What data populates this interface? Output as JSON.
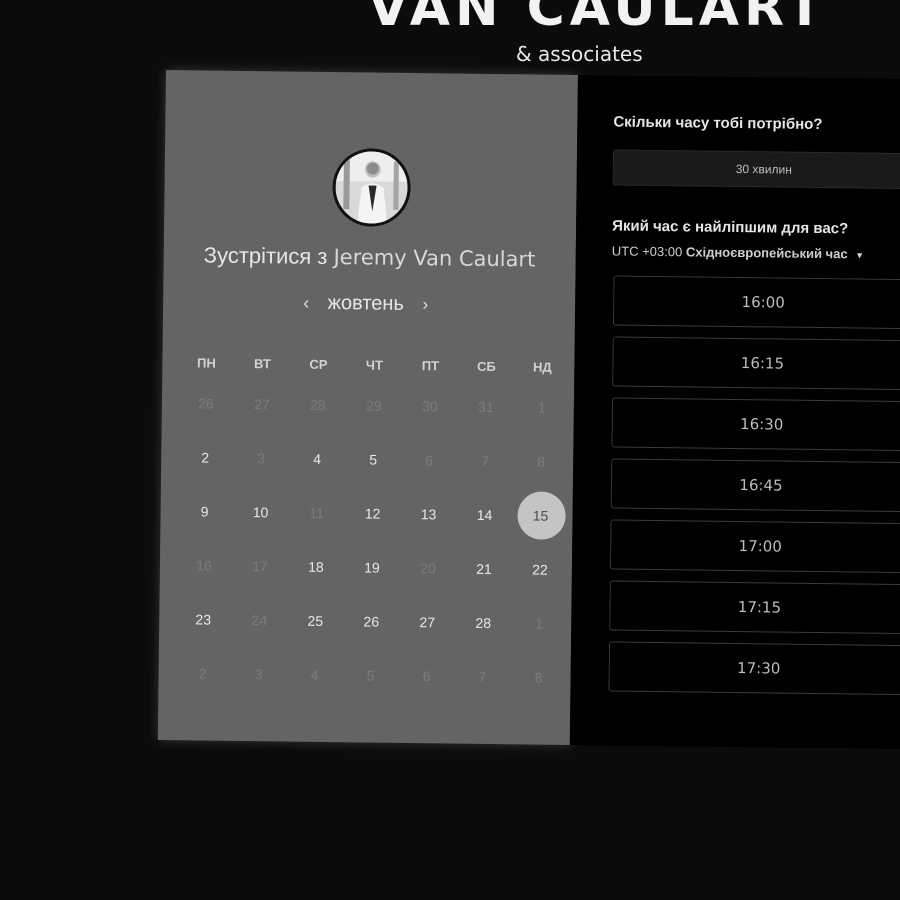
{
  "brand": {
    "name": "VAN CAULART",
    "sub": "& associates"
  },
  "calendar": {
    "title_prefix": "Зустрітися з",
    "host_name": "Jeremy Van Caulart",
    "month": "жовтень",
    "prev_icon": "‹",
    "next_icon": "›",
    "weekdays": [
      "ПН",
      "ВТ",
      "СР",
      "ЧТ",
      "ПТ",
      "СБ",
      "НД"
    ],
    "weeks": [
      [
        {
          "d": "26",
          "dim": true
        },
        {
          "d": "27",
          "dim": true
        },
        {
          "d": "28",
          "dim": true
        },
        {
          "d": "29",
          "dim": true
        },
        {
          "d": "30",
          "dim": true
        },
        {
          "d": "31",
          "dim": true
        },
        {
          "d": "1",
          "dim": true
        }
      ],
      [
        {
          "d": "2",
          "dim": false
        },
        {
          "d": "3",
          "dim": true
        },
        {
          "d": "4",
          "dim": false
        },
        {
          "d": "5",
          "dim": false
        },
        {
          "d": "6",
          "dim": true
        },
        {
          "d": "7",
          "dim": true
        },
        {
          "d": "8",
          "dim": true
        }
      ],
      [
        {
          "d": "9",
          "dim": false
        },
        {
          "d": "10",
          "dim": false
        },
        {
          "d": "11",
          "dim": true
        },
        {
          "d": "12",
          "dim": false
        },
        {
          "d": "13",
          "dim": false
        },
        {
          "d": "14",
          "dim": false
        },
        {
          "d": "15",
          "dim": false,
          "selected": true
        }
      ],
      [
        {
          "d": "16",
          "dim": true
        },
        {
          "d": "17",
          "dim": true
        },
        {
          "d": "18",
          "dim": false
        },
        {
          "d": "19",
          "dim": false
        },
        {
          "d": "20",
          "dim": true
        },
        {
          "d": "21",
          "dim": false
        },
        {
          "d": "22",
          "dim": false
        }
      ],
      [
        {
          "d": "23",
          "dim": false
        },
        {
          "d": "24",
          "dim": true
        },
        {
          "d": "25",
          "dim": false
        },
        {
          "d": "26",
          "dim": false
        },
        {
          "d": "27",
          "dim": false
        },
        {
          "d": "28",
          "dim": false
        },
        {
          "d": "1",
          "dim": true
        }
      ],
      [
        {
          "d": "2",
          "dim": true
        },
        {
          "d": "3",
          "dim": true
        },
        {
          "d": "4",
          "dim": true
        },
        {
          "d": "5",
          "dim": true
        },
        {
          "d": "6",
          "dim": true
        },
        {
          "d": "7",
          "dim": true
        },
        {
          "d": "8",
          "dim": true
        }
      ]
    ]
  },
  "booking": {
    "duration_question": "Скільки часу тобі потрібно?",
    "duration_value": "30 хвилин",
    "time_question": "Який час є найліпшим для вас?",
    "tz_offset": "UTC +03:00",
    "tz_name": "Східноєвропейський час",
    "slots": [
      "16:00",
      "16:15",
      "16:30",
      "16:45",
      "17:00",
      "17:15",
      "17:30",
      ""
    ]
  }
}
